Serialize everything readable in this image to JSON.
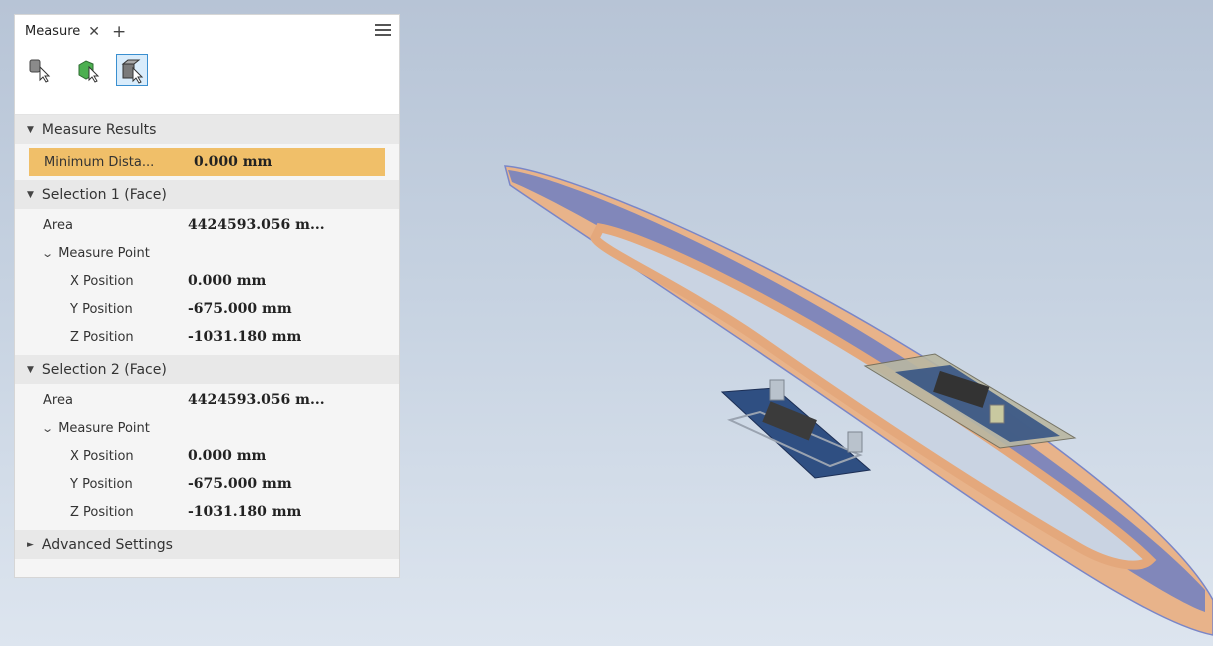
{
  "panel": {
    "tab_label": "Measure",
    "tab_close": "✕",
    "tab_add": "+",
    "tools": [
      {
        "name": "select-part-icon",
        "active": false
      },
      {
        "name": "select-component-icon",
        "active": false
      },
      {
        "name": "select-face-icon",
        "active": true
      }
    ],
    "results_header": "Measure Results",
    "result": {
      "label": "Minimum Dista...",
      "value": "0.000 mm"
    },
    "selection1": {
      "header": "Selection 1 (Face)",
      "area_label": "Area",
      "area_value": "4424593.056 m...",
      "point_label": "Measure Point",
      "x_label": "X Position",
      "x_value": "0.000 mm",
      "y_label": "Y Position",
      "y_value": "-675.000 mm",
      "z_label": "Z Position",
      "z_value": "-1031.180 mm"
    },
    "selection2": {
      "header": "Selection 2 (Face)",
      "area_label": "Area",
      "area_value": "4424593.056 m...",
      "point_label": "Measure Point",
      "x_label": "X Position",
      "x_value": "0.000 mm",
      "y_label": "Y Position",
      "y_value": "-675.000 mm",
      "z_label": "Z Position",
      "z_value": "-1031.180 mm"
    },
    "advanced_header": "Advanced Settings"
  },
  "colors": {
    "highlight": "#f0bf69",
    "active_tool_border": "#3a8fd0",
    "model_track": "#e9b48b",
    "model_face": "#5b68b8"
  }
}
